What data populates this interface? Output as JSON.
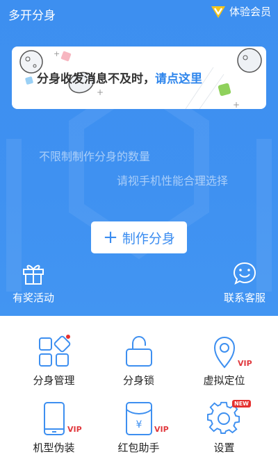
{
  "header": {
    "app_title": "多开分身",
    "vip_label": "体验会员"
  },
  "banner": {
    "text": "分身收发消息不及时，",
    "link_text": "请点这里"
  },
  "hints": {
    "line1": "不限制制作分身的数量",
    "line2": "请视手机性能合理选择"
  },
  "create_button": {
    "icon": "plus",
    "label": "制作分身"
  },
  "corners": {
    "left": {
      "icon": "gift-icon",
      "label": "有奖活动"
    },
    "right": {
      "icon": "chat-smile-icon",
      "label": "联系客服"
    }
  },
  "grid": {
    "items": [
      {
        "label": "分身管理",
        "icon": "apps-grid-icon"
      },
      {
        "label": "分身锁",
        "icon": "lock-icon"
      },
      {
        "label": "虚拟定位",
        "icon": "location-pin-icon",
        "badge": "VIP"
      },
      {
        "label": "机型伪装",
        "icon": "phone-icon",
        "badge": "VIP"
      },
      {
        "label": "红包助手",
        "icon": "red-packet-icon",
        "badge": "VIP",
        "glyph": "¥"
      },
      {
        "label": "设置",
        "icon": "gear-icon",
        "badge": "NEW"
      }
    ]
  },
  "colors": {
    "primary": "#3d8ff0",
    "vip_gold": "#f5c518",
    "badge_red": "#e0393e"
  }
}
